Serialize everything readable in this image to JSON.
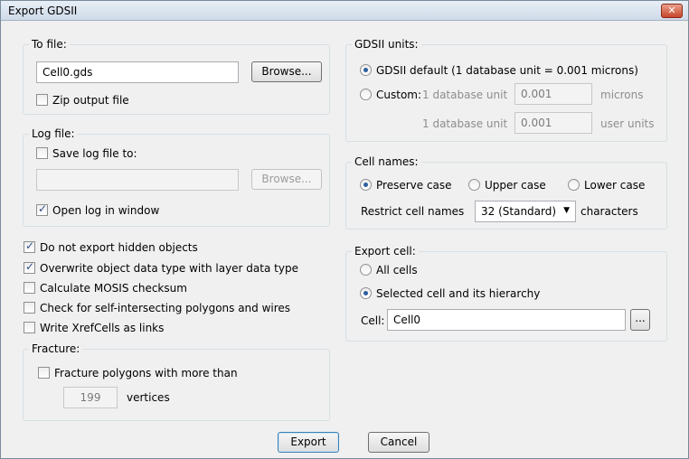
{
  "window": {
    "title": "Export GDSII",
    "close_glyph": "✕"
  },
  "to_file": {
    "label": "To file:",
    "filename": "Cell0.gds",
    "browse": "Browse...",
    "zip": {
      "label": "Zip output file",
      "checked": false
    }
  },
  "log_file": {
    "label": "Log file:",
    "save": {
      "label": "Save log file to:",
      "checked": false
    },
    "path": "",
    "browse": "Browse...",
    "open_in_window": {
      "label": "Open log in window",
      "checked": true
    }
  },
  "options": [
    {
      "label": "Do not export hidden objects",
      "checked": true
    },
    {
      "label": "Overwrite object data type with layer data type",
      "checked": true
    },
    {
      "label": "Calculate MOSIS checksum",
      "checked": false
    },
    {
      "label": "Check for self-intersecting polygons and wires",
      "checked": false
    },
    {
      "label": "Write XrefCells as links",
      "checked": false
    }
  ],
  "fracture": {
    "label": "Fracture:",
    "checkbox": {
      "label": "Fracture polygons with more than",
      "checked": false
    },
    "vertices_value": "199",
    "vertices_label": "vertices"
  },
  "units": {
    "label": "GDSII units:",
    "default_option": "GDSII default (1 database unit = 0.001 microns)",
    "custom_option": "Custom:",
    "row1_prefix": "1 database unit",
    "row1_value": "0.001",
    "row1_suffix": "microns",
    "row2_prefix": "1 database unit",
    "row2_value": "0.001",
    "row2_suffix": "user units"
  },
  "cell_names": {
    "label": "Cell names:",
    "preserve": "Preserve case",
    "upper": "Upper case",
    "lower": "Lower case",
    "restrict_label": "Restrict cell names",
    "restrict_value": "32 (Standard)",
    "restrict_suffix": "characters"
  },
  "export_cell": {
    "label": "Export cell:",
    "all": "All cells",
    "selected": "Selected cell and its hierarchy",
    "cell_label": "Cell:",
    "cell_value": "Cell0",
    "ellipsis": "..."
  },
  "buttons": {
    "export": "Export",
    "cancel": "Cancel"
  }
}
